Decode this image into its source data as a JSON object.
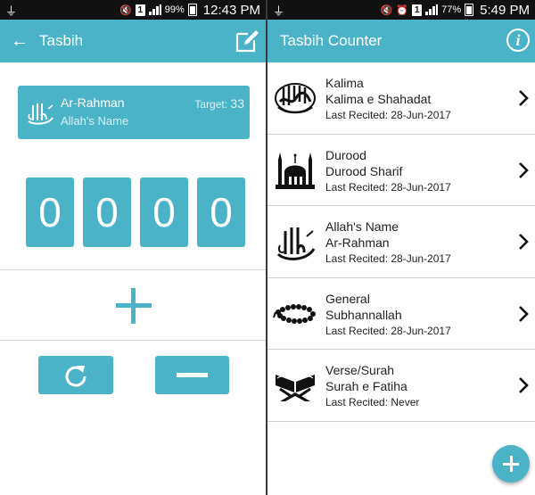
{
  "left": {
    "status": {
      "battery_pct": "99%",
      "time": "12:43 PM",
      "sim_label": "1"
    },
    "appbar": {
      "title": "Tasbih"
    },
    "card": {
      "name": "Ar-Rahman",
      "subtitle": "Allah's Name",
      "target_label": "Target:",
      "target_value": "33"
    },
    "counter": {
      "digits": [
        "0",
        "0",
        "0",
        "0"
      ]
    }
  },
  "right": {
    "status": {
      "battery_pct": "77%",
      "time": "5:49 PM",
      "sim_label": "1"
    },
    "appbar": {
      "title": "Tasbih Counter",
      "info_glyph": "i"
    },
    "items": [
      {
        "category": "Kalima",
        "name": "Kalima e Shahadat",
        "last": "Last Recited: 28-Jun-2017",
        "icon": "kalima-calligraphy-icon"
      },
      {
        "category": "Durood",
        "name": "Durood Sharif",
        "last": "Last Recited: 28-Jun-2017",
        "icon": "mosque-icon"
      },
      {
        "category": "Allah's Name",
        "name": "Ar-Rahman",
        "last": "Last Recited: 28-Jun-2017",
        "icon": "allah-calligraphy-icon"
      },
      {
        "category": "General",
        "name": "Subhannallah",
        "last": "Last Recited: 28-Jun-2017",
        "icon": "prayer-beads-icon"
      },
      {
        "category": "Verse/Surah",
        "name": "Surah e Fatiha",
        "last": "Last Recited: Never",
        "icon": "quran-stand-icon"
      }
    ]
  },
  "colors": {
    "accent": "#4bb3c8",
    "status_bar": "#111111",
    "divider": "#d6d6d6"
  }
}
